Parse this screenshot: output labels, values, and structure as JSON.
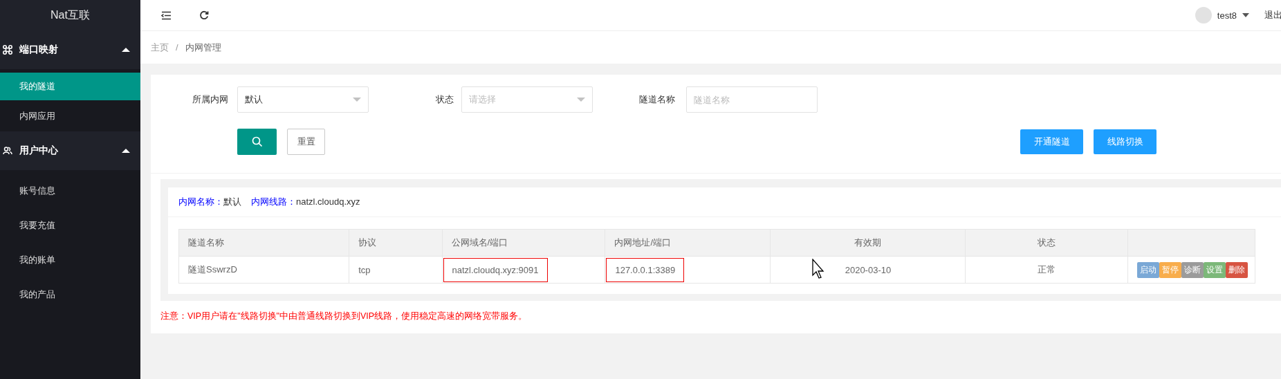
{
  "logo": "Nat互联",
  "sidebar": {
    "groups": [
      {
        "label": "端口映射",
        "expanded": true,
        "items": [
          {
            "label": "我的隧道",
            "selected": true
          },
          {
            "label": "内网应用",
            "selected": false
          }
        ]
      },
      {
        "label": "用户中心",
        "expanded": true,
        "items": [
          {
            "label": "账号信息",
            "selected": false
          },
          {
            "label": "我要充值",
            "selected": false
          },
          {
            "label": "我的账单",
            "selected": false
          },
          {
            "label": "我的产品",
            "selected": false
          }
        ]
      }
    ]
  },
  "header": {
    "user": "test8",
    "logout": "退出"
  },
  "breadcrumb": {
    "items": [
      "主页",
      "内网管理"
    ],
    "separator": "/"
  },
  "filters": [
    {
      "label": "所属内网",
      "kind": "select",
      "value": "默认"
    },
    {
      "label": "状态",
      "kind": "select",
      "placeholder": "请选择"
    },
    {
      "label": "隧道名称",
      "kind": "input",
      "placeholder": "隧道名称"
    }
  ],
  "reset_button": "重置",
  "actions": [
    "开通隧道",
    "线路切换"
  ],
  "network": {
    "name_label": "内网名称：",
    "name": "默认",
    "line_label": "内网线路：",
    "line": "natzl.cloudq.xyz"
  },
  "table": {
    "columns": [
      "隧道名称",
      "协议",
      "公网域名/端口",
      "内网地址/端口",
      "有效期",
      "状态"
    ],
    "rows": [
      {
        "cells": [
          {
            "text": "隧道SswrzD",
            "highlighted": false
          },
          {
            "text": "tcp",
            "highlighted": false
          },
          {
            "text": "natzl.cloudq.xyz:9091",
            "highlighted": true
          },
          {
            "text": "127.0.0.1:3389",
            "highlighted": true
          },
          {
            "text": "2020-03-10",
            "highlighted": false
          },
          {
            "text": "正常",
            "highlighted": false
          }
        ],
        "actions": [
          {
            "label": "启动",
            "color": "#7aa8d6"
          },
          {
            "label": "暂停",
            "color": "#f8ad4c"
          },
          {
            "label": "诊断",
            "color": "#9b9b9b"
          },
          {
            "label": "设置",
            "color": "#7cb879"
          },
          {
            "label": "删除",
            "color": "#d75442"
          }
        ]
      }
    ]
  },
  "notice": "注意：VIP用户请在\"线路切换\"中由普通线路切换到VIP线路，使用稳定高速的网络宽带服务。"
}
